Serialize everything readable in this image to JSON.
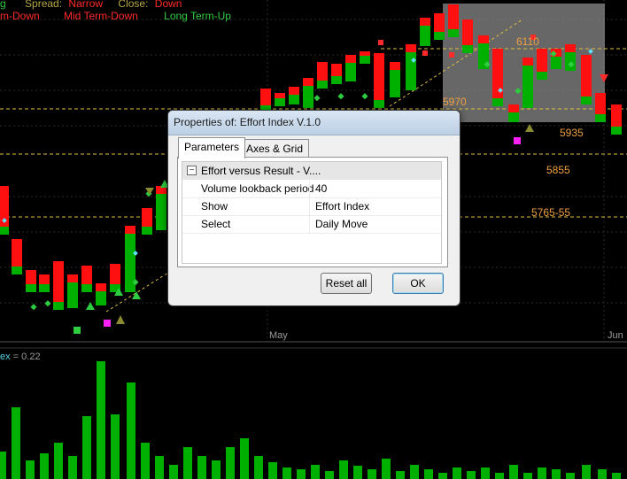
{
  "header": {
    "line1": [
      {
        "text": "g",
        "color": "#2ecc40"
      },
      {
        "text": "Spread:",
        "color": "#b5a642"
      },
      {
        "text": "Narrow",
        "color": "#ff2a2a"
      },
      {
        "text": "Close:",
        "color": "#b5a642"
      },
      {
        "text": "Down",
        "color": "#ff2a2a"
      }
    ],
    "line2": [
      {
        "text": "m-Down",
        "color": "#ff2a2a"
      },
      {
        "text": "Mid Term-Down",
        "color": "#ff2a2a"
      },
      {
        "text": "Long Term-Up",
        "color": "#2ecc40"
      }
    ]
  },
  "levels": [
    "6110",
    "5970",
    "5935",
    "5855",
    "5765-55"
  ],
  "x_axis_labels": [
    "May",
    "Jun"
  ],
  "indicator": {
    "name": "ex",
    "value": "= 0.22"
  },
  "dialog": {
    "title": "Properties of: Effort Index V.1.0",
    "tabs": [
      "Parameters",
      "Axes & Grid"
    ],
    "category": "Effort versus Result - V....",
    "rows": [
      {
        "key": "Volume lookback period",
        "value": "40"
      },
      {
        "key": "Show",
        "value": "Effort Index"
      },
      {
        "key": "Select",
        "value": "Daily Move"
      }
    ],
    "reset_label": "Reset all",
    "ok_label": "OK"
  },
  "colors": {
    "up": "#00b000",
    "down": "#ff1010",
    "level": "#f0a040",
    "volume": "#00b000"
  }
}
